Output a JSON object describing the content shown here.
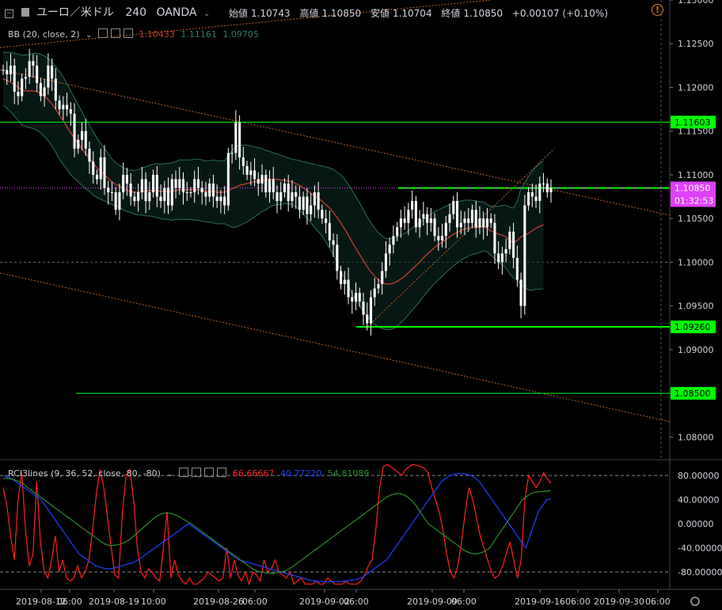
{
  "header": {
    "symbol": "ユーロ／米ドル",
    "interval": "240",
    "broker": "OANDA",
    "ohlc": [
      {
        "label": "始値",
        "value": "1.10743"
      },
      {
        "label": "高値",
        "value": "1.10850"
      },
      {
        "label": "安値",
        "value": "1.10704"
      },
      {
        "label": "終値",
        "value": "1.10850"
      }
    ],
    "change": "+0.00107 (+0.10%)"
  },
  "bb_legend": {
    "title": "BB (20, close, 2)",
    "values": [
      "1.10433",
      "1.11161",
      "1.09705"
    ],
    "colors": [
      "#c0392b",
      "#2e7d67",
      "#2e7d67"
    ]
  },
  "rci_legend": {
    "title": "RCI3lines (9, 36, 52, close, 80, -80)",
    "values": [
      "66.66667",
      "40.77220",
      "54.81089"
    ],
    "colors": [
      "#ff2222",
      "#2040ff",
      "#2e8b2e"
    ]
  },
  "colors": {
    "background": "#000000",
    "up_candle": "#ffffff",
    "down_candle": "#ffffff",
    "bb_mid": "#b03a2e",
    "bb_band": "#2c6e5a",
    "hline": "#00ff00",
    "trendline": "#c0632b",
    "price_line": "#e040fb",
    "alert": "#e67e22"
  },
  "chart_data": [
    {
      "type": "candlestick",
      "title": "ユーロ／米ドル 240 OANDA",
      "ylim": [
        1.0775,
        1.13
      ],
      "y_ticks": [
        "1.13000",
        "1.12500",
        "1.12000",
        "1.11500",
        "1.11000",
        "1.10500",
        "1.10000",
        "1.09500",
        "1.09000",
        "1.08500",
        "1.08000"
      ],
      "x_ticks": [
        "2019-08-12",
        "06:00",
        "2019-08-19",
        "10:00",
        "2019-08-26",
        "06:00",
        "2019-09-02",
        "06:00",
        "2019-09-09",
        "06:00",
        "2019-09-16",
        "06:00",
        "2019-09-30",
        "06:00"
      ],
      "horizontal_lines": [
        {
          "value": 1.11603,
          "label": "1.11603"
        },
        {
          "value": 1.10849,
          "label": "1.10849"
        },
        {
          "value": 1.0926,
          "label": "1.09260"
        },
        {
          "value": 1.085,
          "label": "1.08500"
        }
      ],
      "current_price": {
        "value": 1.1085,
        "label": "1.10850",
        "countdown": "01:32:53"
      },
      "close": [
        1.122,
        1.1215,
        1.1225,
        1.1195,
        1.119,
        1.121,
        1.1212,
        1.123,
        1.1225,
        1.1205,
        1.119,
        1.12,
        1.1225,
        1.121,
        1.1185,
        1.1175,
        1.118,
        1.1175,
        1.117,
        1.113,
        1.114,
        1.115,
        1.113,
        1.1115,
        1.11,
        1.1095,
        1.112,
        1.1085,
        1.108,
        1.108,
        1.106,
        1.108,
        1.11,
        1.109,
        1.1075,
        1.107,
        1.108,
        1.1095,
        1.107,
        1.108,
        1.11,
        1.1075,
        1.107,
        1.1085,
        1.1065,
        1.1095,
        1.1085,
        1.1095,
        1.108,
        1.108,
        1.108,
        1.1095,
        1.1085,
        1.108,
        1.1075,
        1.109,
        1.1075,
        1.107,
        1.1075,
        1.1065,
        1.1125,
        1.1125,
        1.116,
        1.112,
        1.111,
        1.11,
        1.1105,
        1.1095,
        1.109,
        1.11,
        1.108,
        1.1095,
        1.108,
        1.107,
        1.108,
        1.109,
        1.107,
        1.108,
        1.1075,
        1.106,
        1.1075,
        1.1055,
        1.1065,
        1.108,
        1.106,
        1.105,
        1.1045,
        1.1025,
        1.102,
        1.099,
        1.0975,
        1.098,
        1.096,
        1.0955,
        1.0965,
        1.0955,
        1.094,
        1.093,
        1.096,
        1.097,
        1.0975,
        1.099,
        1.101,
        1.102,
        1.103,
        1.104,
        1.105,
        1.1045,
        1.106,
        1.107,
        1.104,
        1.105,
        1.1055,
        1.1045,
        1.105,
        1.103,
        1.1025,
        1.103,
        1.1045,
        1.1055,
        1.107,
        1.104,
        1.1045,
        1.105,
        1.1045,
        1.106,
        1.104,
        1.105,
        1.104,
        1.105,
        1.1045,
        1.101,
        1.1,
        1.101,
        1.1015,
        1.1035,
        1.1005,
        1.098,
        1.095,
        1.1065,
        1.108,
        1.1075,
        1.107,
        1.109,
        1.109,
        1.108,
        1.1085
      ],
      "bb_mid": [
        1.121,
        1.1208,
        1.1206,
        1.1203,
        1.12,
        1.1197,
        1.1196,
        1.1196,
        1.1196,
        1.1195,
        1.1193,
        1.119,
        1.1186,
        1.1181,
        1.1175,
        1.1168,
        1.1162,
        1.1155,
        1.1148,
        1.1142,
        1.1136,
        1.113,
        1.1124,
        1.1119,
        1.1113,
        1.1108,
        1.1104,
        1.11,
        1.1096,
        1.1092,
        1.1089,
        1.1087,
        1.1084,
        1.1082,
        1.1081,
        1.108,
        1.108,
        1.1081,
        1.1081,
        1.1082,
        1.1082,
        1.1082,
        1.1081,
        1.1081,
        1.1081,
        1.1081,
        1.1082,
        1.1083,
        1.1083,
        1.1083,
        1.1083,
        1.1083,
        1.1083,
        1.1082,
        1.1081,
        1.1081,
        1.1081,
        1.108,
        1.108,
        1.108,
        1.1082,
        1.1084,
        1.1086,
        1.1088,
        1.1089,
        1.109,
        1.1091,
        1.1092,
        1.1093,
        1.1094,
        1.1094,
        1.1095,
        1.1095,
        1.1095,
        1.1094,
        1.1094,
        1.1093,
        1.1092,
        1.109,
        1.1088,
        1.1085,
        1.1082,
        1.1079,
        1.1076,
        1.1073,
        1.107,
        1.1066,
        1.1062,
        1.1057,
        1.1051,
        1.1045,
        1.1038,
        1.1031,
        1.1023,
        1.1016,
        1.1009,
        1.1002,
        1.0995,
        1.0989,
        1.0984,
        1.098,
        1.0977,
        1.0975,
        1.0975,
        1.0976,
        1.0978,
        1.0981,
        1.0984,
        1.0988,
        1.0992,
        1.0996,
        1.1,
        1.1005,
        1.1009,
        1.1013,
        1.1017,
        1.102,
        1.1023,
        1.1026,
        1.1029,
        1.1032,
        1.1034,
        1.1036,
        1.1038,
        1.1039,
        1.104,
        1.104,
        1.104,
        1.1041,
        1.1039,
        1.1036,
        1.1034,
        1.1032,
        1.1031,
        1.1029,
        1.1025,
        1.1022,
        1.1025,
        1.1029,
        1.1031,
        1.1033,
        1.1036,
        1.1039,
        1.1041,
        1.1043
      ],
      "bb_width": [
        0.003,
        0.0032,
        0.0034,
        0.0036,
        0.0038,
        0.004,
        0.0041,
        0.0042,
        0.0043,
        0.0044,
        0.0045,
        0.0046,
        0.0047,
        0.0048,
        0.0049,
        0.005,
        0.005,
        0.0049,
        0.0048,
        0.0046,
        0.0044,
        0.0042,
        0.004,
        0.0038,
        0.0036,
        0.0034,
        0.0032,
        0.003,
        0.0028,
        0.0026,
        0.0025,
        0.0024,
        0.0024,
        0.0024,
        0.0024,
        0.0025,
        0.0026,
        0.0027,
        0.0028,
        0.0029,
        0.003,
        0.0031,
        0.0031,
        0.0032,
        0.0032,
        0.0033,
        0.0033,
        0.0034,
        0.0034,
        0.0034,
        0.0034,
        0.0035,
        0.0035,
        0.0035,
        0.0035,
        0.0035,
        0.0036,
        0.0036,
        0.0036,
        0.0036,
        0.004,
        0.0044,
        0.0046,
        0.0046,
        0.0045,
        0.0044,
        0.0042,
        0.004,
        0.0038,
        0.0036,
        0.0034,
        0.0032,
        0.003,
        0.0029,
        0.0028,
        0.0027,
        0.0026,
        0.0026,
        0.0027,
        0.0028,
        0.003,
        0.0032,
        0.0034,
        0.0036,
        0.0038,
        0.004,
        0.0043,
        0.0046,
        0.0049,
        0.0052,
        0.0055,
        0.0057,
        0.0058,
        0.0059,
        0.0059,
        0.0059,
        0.0058,
        0.0057,
        0.0056,
        0.0055,
        0.0054,
        0.0053,
        0.0052,
        0.0052,
        0.0052,
        0.0051,
        0.005,
        0.0049,
        0.0048,
        0.0047,
        0.0046,
        0.0045,
        0.0044,
        0.0043,
        0.0042,
        0.0041,
        0.004,
        0.0039,
        0.0038,
        0.0037,
        0.0036,
        0.0035,
        0.0034,
        0.0033,
        0.0032,
        0.0031,
        0.003,
        0.0029,
        0.0028,
        0.0027,
        0.0028,
        0.003,
        0.0032,
        0.0034,
        0.0036,
        0.0038,
        0.004,
        0.0045,
        0.0055,
        0.006,
        0.0065,
        0.0068,
        0.007,
        0.0072,
        0.0073,
        0.0073,
        0.0073
      ]
    },
    {
      "type": "line",
      "title": "RCI3lines (9, 36, 52, close, 80, -80)",
      "ylim": [
        -105,
        105
      ],
      "y_ticks": [
        "80.00000",
        "40.00000",
        "0.00000",
        "-40.00000",
        "-80.00000"
      ],
      "reference_lines": [
        80,
        -80
      ],
      "series": [
        {
          "name": "66.66667",
          "color": "#ff2222",
          "values": [
            60,
            30,
            -20,
            -60,
            40,
            85,
            -10,
            -70,
            -50,
            70,
            -30,
            -80,
            -90,
            -60,
            -20,
            -80,
            -60,
            -90,
            -95,
            -90,
            -70,
            -90,
            -80,
            -60,
            -10,
            50,
            90,
            60,
            10,
            -40,
            -85,
            -90,
            20,
            80,
            90,
            40,
            -40,
            -80,
            -90,
            -75,
            -80,
            -90,
            -95,
            -40,
            20,
            -90,
            -60,
            -85,
            -95,
            -100,
            -90,
            -100,
            -100,
            -95,
            -90,
            -80,
            -85,
            -90,
            -95,
            -90,
            -40,
            -90,
            -60,
            -85,
            -95,
            -80,
            -100,
            -80,
            -85,
            -95,
            -60,
            -80,
            -75,
            -60,
            -80,
            -85,
            -90,
            -80,
            -100,
            -95,
            -90,
            -100,
            -100,
            -100,
            -95,
            -100,
            -100,
            -90,
            -95,
            -100,
            -100,
            -100,
            -95,
            -100,
            -100,
            -100,
            -95,
            -85,
            -70,
            -60,
            -10,
            60,
            95,
            98,
            95,
            90,
            85,
            80,
            90,
            95,
            98,
            97,
            95,
            92,
            85,
            60,
            40,
            20,
            -10,
            -50,
            -80,
            -90,
            -70,
            -30,
            20,
            60,
            40,
            10,
            -20,
            -40,
            -60,
            -80,
            -90,
            -85,
            -70,
            -50,
            -30,
            -60,
            -90,
            -60,
            40,
            80,
            70,
            60,
            70,
            85,
            75,
            67
          ]
        },
        {
          "name": "40.77220",
          "color": "#2040ff",
          "values": [
            80,
            78,
            75,
            70,
            65,
            60,
            55,
            50,
            45,
            40,
            30,
            20,
            10,
            0,
            -10,
            -20,
            -30,
            -40,
            -50,
            -55,
            -60,
            -65,
            -70,
            -72,
            -74,
            -75,
            -74,
            -72,
            -70,
            -68,
            -66,
            -64,
            -60,
            -55,
            -50,
            -45,
            -40,
            -35,
            -30,
            -25,
            -20,
            -15,
            -10,
            -5,
            0,
            -5,
            -10,
            -15,
            -20,
            -25,
            -30,
            -35,
            -40,
            -45,
            -50,
            -55,
            -60,
            -62,
            -64,
            -66,
            -68,
            -70,
            -72,
            -74,
            -76,
            -78,
            -80,
            -82,
            -84,
            -86,
            -88,
            -90,
            -92,
            -94,
            -95,
            -96,
            -96,
            -96,
            -96,
            -96,
            -96,
            -95,
            -94,
            -93,
            -92,
            -90,
            -85,
            -80,
            -75,
            -70,
            -65,
            -60,
            -50,
            -40,
            -30,
            -20,
            -10,
            0,
            10,
            20,
            30,
            40,
            50,
            60,
            70,
            75,
            80,
            82,
            83,
            83,
            82,
            80,
            76,
            70,
            60,
            50,
            40,
            30,
            20,
            10,
            0,
            -10,
            -20,
            -30,
            -40,
            -20,
            0,
            20,
            30,
            40,
            41
          ]
        },
        {
          "name": "54.81089",
          "color": "#2e8b2e",
          "values": [
            75,
            76,
            74,
            72,
            70,
            66,
            60,
            55,
            50,
            45,
            40,
            35,
            30,
            25,
            20,
            15,
            10,
            5,
            0,
            -5,
            -10,
            -15,
            -20,
            -25,
            -30,
            -34,
            -36,
            -36,
            -35,
            -33,
            -30,
            -26,
            -20,
            -14,
            -8,
            -2,
            4,
            10,
            14,
            17,
            18,
            17,
            15,
            12,
            8,
            4,
            0,
            -5,
            -10,
            -15,
            -20,
            -25,
            -30,
            -35,
            -40,
            -45,
            -50,
            -55,
            -60,
            -65,
            -70,
            -75,
            -78,
            -80,
            -81,
            -82,
            -82,
            -81,
            -80,
            -78,
            -75,
            -70,
            -65,
            -60,
            -55,
            -50,
            -45,
            -40,
            -35,
            -30,
            -25,
            -20,
            -15,
            -10,
            -5,
            0,
            5,
            10,
            15,
            20,
            25,
            30,
            35,
            40,
            45,
            48,
            50,
            50,
            48,
            44,
            38,
            30,
            20,
            10,
            0,
            -5,
            -10,
            -15,
            -20,
            -25,
            -30,
            -35,
            -40,
            -45,
            -48,
            -50,
            -50,
            -48,
            -45,
            -40,
            -30,
            -20,
            -10,
            0,
            10,
            20,
            30,
            40,
            45,
            50,
            52,
            53,
            54,
            54,
            55
          ]
        }
      ]
    }
  ]
}
